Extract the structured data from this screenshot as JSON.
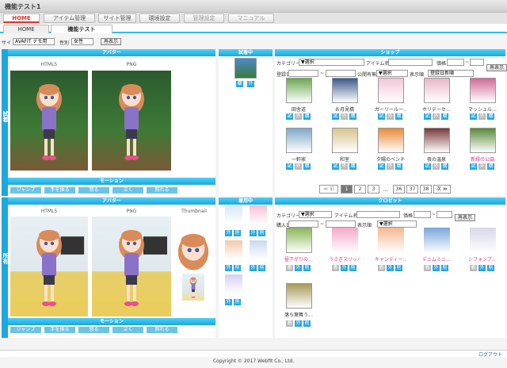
{
  "window_title": "機能テスト1",
  "menu": [
    {
      "label": "HOME",
      "active": true
    },
    {
      "label": "アイテム管理"
    },
    {
      "label": "サイト管理"
    },
    {
      "label": "環境設定"
    },
    {
      "label": "管理設定",
      "dim": true
    },
    {
      "label": "マニュアル",
      "dim": true
    }
  ],
  "tabs": [
    {
      "label": "HOME"
    },
    {
      "label": "機能テスト",
      "active": true
    }
  ],
  "filter": {
    "site_label": "サイト",
    "site_value": "AVAFIT デモ用",
    "gender_label": "性別",
    "gender_value": "女性",
    "show_button": "再表示"
  },
  "trial": {
    "side_label": "試着",
    "avatar_header": "アバター",
    "html5_label": "HTML5",
    "png_label": "PNG",
    "motion_header": "モーション",
    "motions": [
      "ジャンプ",
      "手を振る",
      "怒る",
      "泣く",
      "照れる"
    ],
    "wearing_header": "試着中",
    "shop": {
      "header": "ショップ",
      "category_label": "カテゴリー",
      "category_value": "▼選択",
      "item_name_label": "アイテム名",
      "price_label": "価格",
      "tilde": "~",
      "registered_label": "登録日",
      "public_label": "公開有無",
      "public_value": "▼選択",
      "order_label": "表示順",
      "order_value": "登録日新順",
      "reload_button": "再表示",
      "items": [
        {
          "name": "田舎道",
          "color": "#6aa84f"
        },
        {
          "name": "お月見橋",
          "color": "#3d5a8a"
        },
        {
          "name": "ガーリールー…",
          "color": "#f4c6d8"
        },
        {
          "name": "ホリデーセ…",
          "color": "#e8b8c8"
        },
        {
          "name": "マッシュル…",
          "color": "#d06a9a"
        },
        {
          "name": "一軒家",
          "color": "#7fa7c8"
        },
        {
          "name": "和室",
          "color": "#d8c490"
        },
        {
          "name": "夕陽のベンチ",
          "color": "#e88a3a"
        },
        {
          "name": "夜の温泉",
          "color": "#7a3a3a"
        },
        {
          "name": "新緑の公園",
          "color": "#5a8a3a",
          "pink": true
        }
      ],
      "item_buttons": [
        "試",
        "外",
        "購"
      ],
      "pagination": {
        "prev": "≪ 前",
        "pages": [
          "1",
          "2",
          "3"
        ],
        "ellipsis": "…",
        "pages_end": [
          "36",
          "37",
          "38"
        ],
        "next": "次 ≫",
        "current": "1"
      }
    },
    "wearing_buttons": [
      "購",
      "外"
    ]
  },
  "owned": {
    "side_label": "所有",
    "avatar_header": "アバター",
    "html5_label": "HTML5",
    "png_label": "PNG",
    "thumbnail_label": "Thumbnail",
    "motion_header": "モーション",
    "motions": [
      "ジャンプ",
      "手を振る",
      "怒る",
      "泣く",
      "照れる"
    ],
    "wearing_header": "着用中",
    "wearing_buttons": [
      "外",
      "削"
    ],
    "closet": {
      "header": "クロゼット",
      "category_label": "カテゴリー",
      "category_value": "▼選択",
      "item_name_label": "アイテム名",
      "price_label": "価格",
      "tilde": "~",
      "purchased_label": "購入日",
      "order_label": "表示順",
      "order_value": "▼選択",
      "reload_button": "再表示",
      "items": [
        {
          "name": "昼下がりの…",
          "color": "#8aba5a"
        },
        {
          "name": "うさぎスリッパ",
          "color": "#f4a8c8"
        },
        {
          "name": "キャンディー…",
          "color": "#f4b890"
        },
        {
          "name": "デニムミニ…",
          "color": "#7aa8d8"
        },
        {
          "name": "シフォンブ…",
          "color": "#d8d8e8"
        },
        {
          "name": "落ち葉舞う…",
          "color": "#a89a5a",
          "black": true
        }
      ],
      "item_buttons": [
        "着",
        "外",
        "削"
      ]
    }
  },
  "logout": "ログアウト",
  "copyright": "Copyright © 2017 Webfit Co., Ltd."
}
